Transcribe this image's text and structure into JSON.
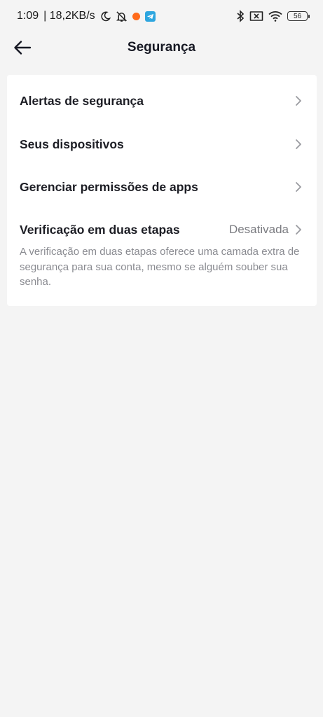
{
  "status_bar": {
    "time": "1:09",
    "speed": "| 18,2KB/s",
    "battery": "56"
  },
  "header": {
    "title": "Segurança"
  },
  "settings": {
    "items": [
      {
        "label": "Alertas de segurança"
      },
      {
        "label": "Seus dispositivos"
      },
      {
        "label": "Gerenciar permissões de apps"
      },
      {
        "label": "Verificação em duas etapas",
        "value": "Desativada"
      }
    ],
    "two_step_description": "A verificação em duas etapas oferece uma camada extra de segurança para sua conta, mesmo se alguém souber sua senha."
  }
}
